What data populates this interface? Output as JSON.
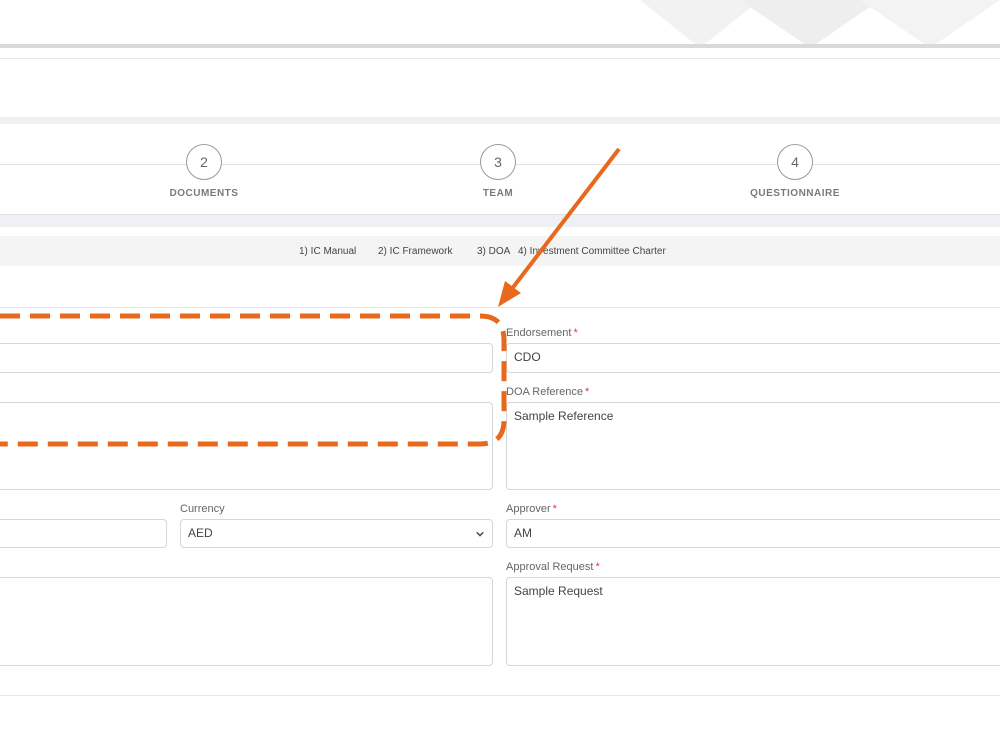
{
  "banner": {
    "fragment_left": "",
    "fragment_right": ""
  },
  "steps": [
    {
      "number": "2",
      "label": "DOCUMENTS"
    },
    {
      "number": "3",
      "label": "TEAM"
    },
    {
      "number": "4",
      "label": "QUESTIONNAIRE"
    }
  ],
  "documents": [
    "1) IC Manual",
    "2) IC Framework",
    "3) DOA",
    "4) Investment Committee Charter"
  ],
  "form": {
    "currency_label": "Currency",
    "currency_value": "AED",
    "endorsement_label": "Endorsement",
    "endorsement_value": "CDO",
    "doa_reference_label": "DOA Reference",
    "doa_reference_value": "Sample Reference",
    "approver_label": "Approver",
    "approver_value": "AM",
    "approval_request_label": "Approval Request",
    "approval_request_value": "Sample Request",
    "required_mark": "*"
  },
  "colors": {
    "annotation": "#e8691e",
    "required": "#e2364b"
  },
  "icons": {
    "currency_dropdown": "chevron-down-icon",
    "annotation_arrow": "arrow-icon"
  }
}
